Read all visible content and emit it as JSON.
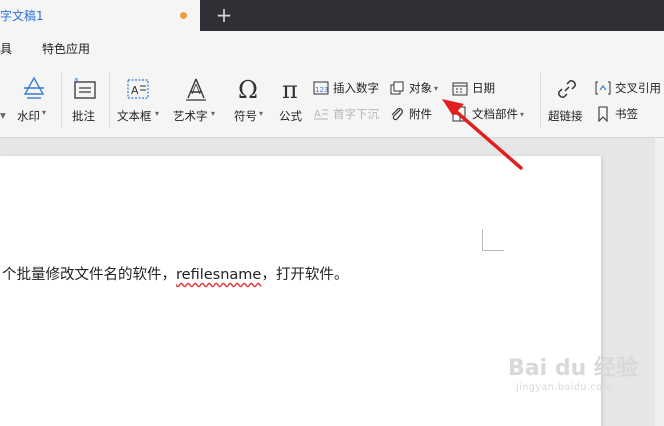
{
  "tab": {
    "title": "字文稿1",
    "new_tab": "+",
    "dot_color": "#f39a3c"
  },
  "menu": {
    "items": [
      "工具",
      "特色应用"
    ]
  },
  "ribbon": {
    "watermark_label": "水印",
    "comment_label": "批注",
    "textbox_label": "文本框",
    "wordart_label": "艺术字",
    "symbol_label": "符号",
    "formula_label": "公式",
    "insert_number_label": "插入数字",
    "drop_cap_label": "首字下沉",
    "object_label": "对象",
    "attachment_label": "附件",
    "date_label": "日期",
    "doc_parts_label": "文档部件",
    "hyperlink_label": "超链接",
    "cross_ref_label": "交叉引用",
    "bookmark_label": "书签",
    "caret": "▾"
  },
  "document": {
    "text_before": "个批量修改文件名的软件，",
    "text_misspelled": "refilesname",
    "text_after": "，打开软件。"
  },
  "watermark": {
    "main": "Bai du 经验",
    "sub": "jingyan.baidu.com"
  },
  "colors": {
    "tab_title": "#2b6fd6",
    "arrow": "#e02020",
    "tabbar": "#2f3036"
  }
}
